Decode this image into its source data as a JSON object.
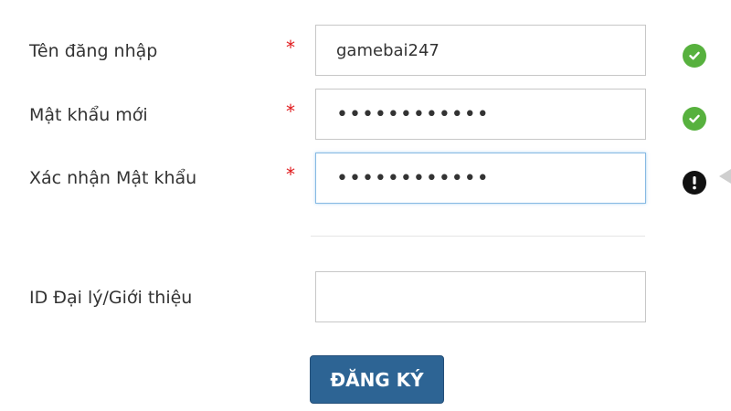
{
  "form": {
    "fields": [
      {
        "label": "Tên đăng nhập",
        "required_mark": "*",
        "value": "gamebai247",
        "status": "valid",
        "status_icon": "check-circle-icon"
      },
      {
        "label": "Mật khẩu mới",
        "required_mark": "*",
        "value": "••••••••••••",
        "status": "valid",
        "status_icon": "check-circle-icon"
      },
      {
        "label": "Xác nhận Mật khẩu",
        "required_mark": "*",
        "value": "••••••••••••",
        "status": "error",
        "status_icon": "exclamation-circle-icon",
        "focused": true
      }
    ],
    "referral": {
      "label": "ID Đại lý/Giới thiệu",
      "value": ""
    },
    "submit_label": "ĐĂNG KÝ"
  },
  "colors": {
    "required": "#e0191c",
    "valid": "#57b13e",
    "error": "#111111",
    "button": "#2d6494",
    "focus_border": "#86b9e3"
  }
}
